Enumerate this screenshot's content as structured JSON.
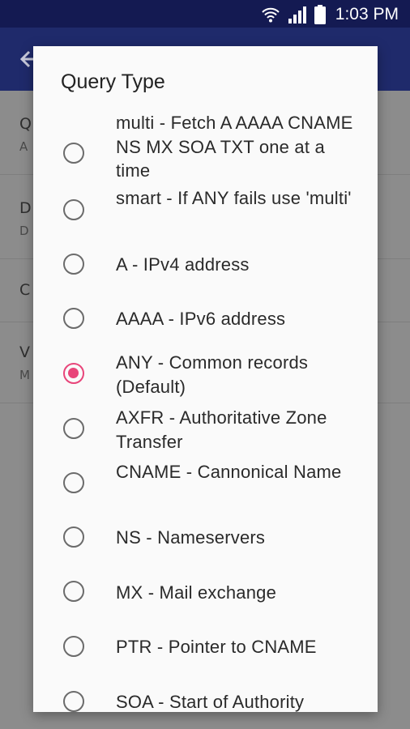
{
  "status_bar": {
    "time": "1:03 PM",
    "icons": [
      "wifi-icon",
      "signal-icon",
      "battery-icon"
    ]
  },
  "background": {
    "settings": [
      {
        "title": "Q",
        "subtitle": "A"
      },
      {
        "title": "D",
        "subtitle": "D"
      },
      {
        "title": "C",
        "subtitle": ""
      },
      {
        "title": "V",
        "subtitle": "M"
      }
    ]
  },
  "dialog": {
    "title": "Query Type",
    "selected_index": 4,
    "options": [
      {
        "label": "multi - Fetch A AAAA CNAME NS MX SOA TXT one at a time",
        "checked": false
      },
      {
        "label": "smart - If ANY fails use 'multi'",
        "checked": false
      },
      {
        "label": "A - IPv4 address",
        "checked": false
      },
      {
        "label": "AAAA - IPv6 address",
        "checked": false
      },
      {
        "label": "ANY - Common records (Default)",
        "checked": true
      },
      {
        "label": "AXFR - Authoritative Zone Transfer",
        "checked": false
      },
      {
        "label": "CNAME - Cannonical Name",
        "checked": false
      },
      {
        "label": "NS - Nameservers",
        "checked": false
      },
      {
        "label": "MX - Mail exchange",
        "checked": false
      },
      {
        "label": "PTR - Pointer to CNAME",
        "checked": false
      },
      {
        "label": "SOA - Start of Authority",
        "checked": false
      }
    ]
  },
  "colors": {
    "status_bar": "#141a52",
    "app_bar": "#1f2a6b",
    "accent": "#e8457a",
    "scrim": "#8c8c8c",
    "dialog_bg": "#fafafa"
  }
}
